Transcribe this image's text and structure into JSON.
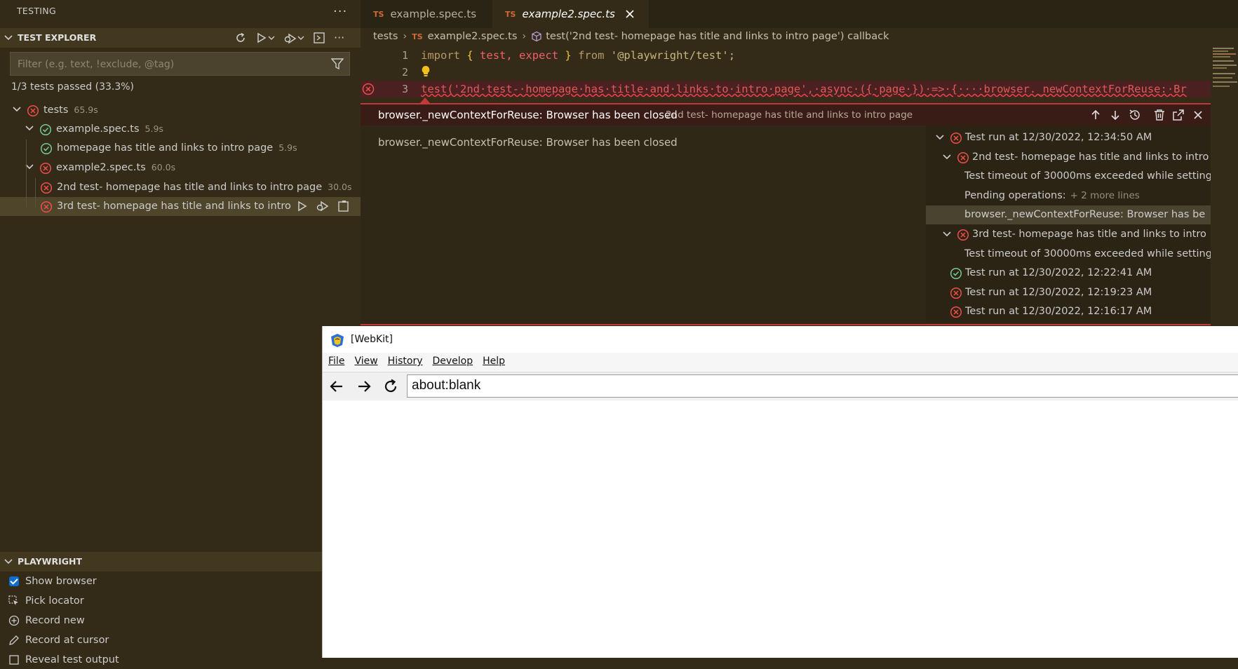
{
  "sidebar": {
    "title": "TESTING",
    "test_explorer": {
      "header": "TEST EXPLORER",
      "filter_placeholder": "Filter (e.g. text, !exclude, @tag)",
      "summary": "1/3 tests passed (33.3%)",
      "tree": [
        {
          "name": "tests",
          "duration": "65.9s",
          "status": "failed",
          "level": 0
        },
        {
          "name": "example.spec.ts",
          "duration": "5.9s",
          "status": "passed",
          "level": 1
        },
        {
          "name": "homepage has title and links to intro page",
          "duration": "5.9s",
          "status": "passed",
          "level": 2
        },
        {
          "name": "example2.spec.ts",
          "duration": "60.0s",
          "status": "failed",
          "level": 1
        },
        {
          "name": "2nd test- homepage has title and links to intro page",
          "duration": "30.0s",
          "status": "failed",
          "level": 2
        },
        {
          "name": "3rd test- homepage has title and links to intro",
          "duration": "",
          "status": "failed",
          "level": 2,
          "selected": true
        }
      ]
    },
    "playwright": {
      "header": "PLAYWRIGHT",
      "items": [
        {
          "label": "Show browser",
          "icon": "checkbox-checked"
        },
        {
          "label": "Pick locator",
          "icon": "pick-locator-icon"
        },
        {
          "label": "Record new",
          "icon": "circle-plus-icon"
        },
        {
          "label": "Record at cursor",
          "icon": "pencil-icon"
        },
        {
          "label": "Reveal test output",
          "icon": "output-icon"
        }
      ]
    }
  },
  "editor": {
    "tabs": [
      {
        "label": "example.spec.ts",
        "lang": "TS",
        "active": false
      },
      {
        "label": "example2.spec.ts",
        "lang": "TS",
        "active": true
      }
    ],
    "breadcrumb": {
      "folder": "tests",
      "file": "example2.spec.ts",
      "symbol": "test('2nd test- homepage has title and links to intro page') callback"
    },
    "lines": {
      "n1": "1",
      "n2": "2",
      "n3": "3",
      "import_kw": "import",
      "open_brace": "{",
      "test_id": "test,",
      "expect_id": "expect",
      "close_brace": "}",
      "from_kw": "from",
      "module": "'@playwright/test';",
      "line3": "test('2nd·test-·homepage·has·title·and·links·to·intro·page',·async·({·page·})·=>·{····browser._newContextForReuse:·Br"
    },
    "peek": {
      "error_title": "browser._newContextForReuse: Browser has been closed",
      "test_name": "2nd test- homepage has title and links to intro page",
      "message": "browser._newContextForReuse: Browser has been closed",
      "history": [
        {
          "text": "Test run at 12/30/2022, 12:34:50 AM",
          "status": "failed",
          "indent": 0,
          "twistie": true
        },
        {
          "text": "2nd test- homepage has title and links to intro",
          "status": "failed",
          "indent": 1,
          "twistie": true
        },
        {
          "text": "Test timeout of 30000ms exceeded while setting",
          "status": "",
          "indent": 2,
          "twistie": false
        },
        {
          "text": "Pending operations:",
          "more": "+ 2 more lines",
          "status": "",
          "indent": 2,
          "twistie": false
        },
        {
          "text": "browser._newContextForReuse: Browser has be",
          "status": "",
          "indent": 2,
          "twistie": false,
          "selected": true
        },
        {
          "text": "3rd test- homepage has title and links to intro",
          "status": "failed",
          "indent": 1,
          "twistie": true
        },
        {
          "text": "Test timeout of 30000ms exceeded while setting",
          "status": "",
          "indent": 2,
          "twistie": false
        },
        {
          "text": "Test run at 12/30/2022, 12:22:41 AM",
          "status": "passed",
          "indent": 0,
          "twistie": false
        },
        {
          "text": "Test run at 12/30/2022, 12:19:23 AM",
          "status": "failed",
          "indent": 0,
          "twistie": false
        },
        {
          "text": "Test run at 12/30/2022, 12:16:17 AM",
          "status": "failed",
          "indent": 0,
          "twistie": false
        }
      ]
    }
  },
  "webkit": {
    "title": "[WebKit]",
    "menu": [
      "File",
      "View",
      "History",
      "Develop",
      "Help"
    ],
    "url": "about:blank"
  },
  "colors": {
    "background": "#332b17",
    "failed": "#f14c4c",
    "passed": "#73c991",
    "accent": "#0f6dd2",
    "peek_border": "#c2383b"
  }
}
